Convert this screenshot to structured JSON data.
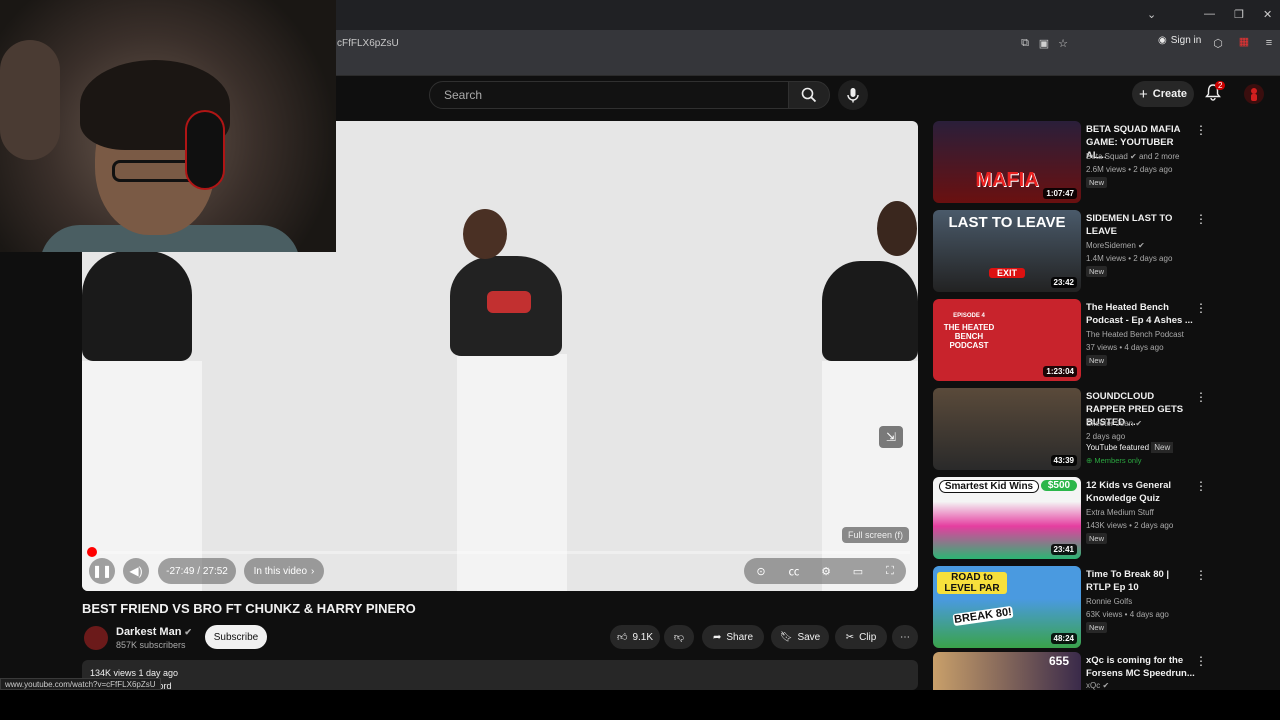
{
  "browser": {
    "url_fragment": "cFfFLX6pZsU",
    "sign_in": "Sign in",
    "status_url": "www.youtube.com/watch?v=cFfFLX6pZsU"
  },
  "header": {
    "search_placeholder": "Search",
    "create_label": "Create",
    "notification_count": "2"
  },
  "player": {
    "time": "-27:49 / 27:52",
    "in_this_video": "In this video",
    "fullscreen_tooltip": "Full screen (f)",
    "progress": 0.002
  },
  "video": {
    "title": "BEST FRIEND VS BRO FT CHUNKZ & HARRY PINERO",
    "channel": "Darkest Man",
    "subscribers": "857K subscribers",
    "subscribe_label": "Subscribe",
    "likes": "9.1K",
    "share_label": "Share",
    "save_label": "Save",
    "clip_label": "Clip",
    "meta": "134K views  1 day ago",
    "desc_preview": "word"
  },
  "recommendations": [
    {
      "title": "BETA SQUAD MAFIA GAME: YOUTUBER AL...",
      "channel": "Beta Squad",
      "channel_suffix": "and 2 more",
      "views": "2.6M views • 2 days ago",
      "badge": "New",
      "duration": "1:07:47",
      "thumb_text": "MAFIA"
    },
    {
      "title": "SIDEMEN LAST TO LEAVE",
      "channel": "MoreSidemen",
      "views": "1.4M views • 2 days ago",
      "badge": "New",
      "duration": "23:42",
      "thumb_text": "LAST TO LEAVE",
      "thumb_sub": "EXIT"
    },
    {
      "title": "The Heated Bench Podcast - Ep 4 Ashes ...",
      "channel": "The Heated Bench Podcast",
      "views": "37 views • 4 days ago",
      "badge": "New",
      "duration": "1:23:04",
      "thumb_text": "THE HEATED BENCH PODCAST",
      "thumb_top": "EPISODE 4"
    },
    {
      "title": "SOUNDCLOUD RAPPER PRED GETS BUSTED ...",
      "channel": "Skeeter Jean",
      "views": "2 days ago",
      "featured": "YouTube featured",
      "badge": "New",
      "members": "Members only",
      "duration": "43:39"
    },
    {
      "title": "12 Kids vs General Knowledge Quiz",
      "channel": "Extra Medium Stuff",
      "views": "143K views • 2 days ago",
      "badge": "New",
      "duration": "23:41",
      "thumb_text": "Smartest Kid Wins",
      "thumb_money": "$500"
    },
    {
      "title": "Time To Break 80 | RTLP Ep 10",
      "channel": "Ronnie Golfs",
      "views": "63K views • 4 days ago",
      "badge": "New",
      "duration": "48:24",
      "thumb_text": "ROAD to LEVEL PAR",
      "thumb_sub": "BREAK 80!"
    },
    {
      "title": "xQc is coming for the Forsens MC Speedrun...",
      "channel": "xQc",
      "thumb_text": "655"
    }
  ],
  "colors": {
    "accent": "#ff0000",
    "bg": "#0f0f0f"
  }
}
